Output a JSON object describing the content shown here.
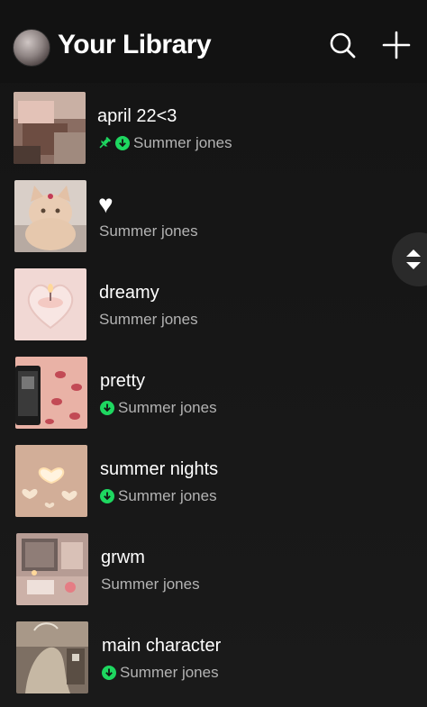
{
  "header": {
    "title": "Your Library",
    "avatar_icon": "profile-avatar",
    "search_icon": "search-icon",
    "add_icon": "plus-icon"
  },
  "colors": {
    "background": "#121212",
    "accent": "#1ed760",
    "text_primary": "#ffffff",
    "text_secondary": "#b3b3b3"
  },
  "playlists": [
    {
      "title": "april 22<3",
      "owner": "Summer jones",
      "pinned": true,
      "downloaded": true
    },
    {
      "title": "♥",
      "owner": "Summer jones",
      "pinned": false,
      "downloaded": false
    },
    {
      "title": "dreamy",
      "owner": "Summer jones",
      "pinned": false,
      "downloaded": false
    },
    {
      "title": "pretty",
      "owner": "Summer jones",
      "pinned": false,
      "downloaded": true
    },
    {
      "title": "summer nights",
      "owner": "Summer jones",
      "pinned": false,
      "downloaded": true
    },
    {
      "title": "grwm",
      "owner": "Summer jones",
      "pinned": false,
      "downloaded": false
    },
    {
      "title": "main character",
      "owner": "Summer jones",
      "pinned": false,
      "downloaded": true
    }
  ],
  "scroll_handle_icon": "scroll-handle-icon"
}
